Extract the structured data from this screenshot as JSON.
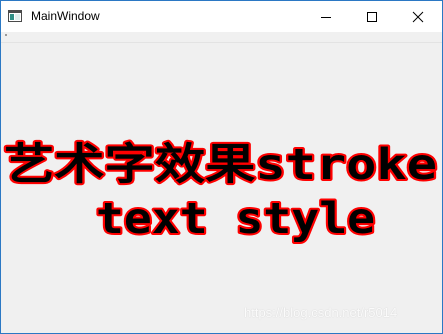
{
  "window": {
    "title": "MainWindow",
    "controls": {
      "minimize_icon": "minimize-icon",
      "maximize_icon": "maximize-icon",
      "close_icon": "close-icon"
    },
    "border_color": "#2b78c4"
  },
  "art_text": {
    "line1_cjk": "艺术字效果",
    "line1_latin": "stroke",
    "line2": "text style",
    "fill_color": "#000000",
    "stroke_color": "#ff0000"
  },
  "watermark": "https://blog.csdn.net/r5014"
}
